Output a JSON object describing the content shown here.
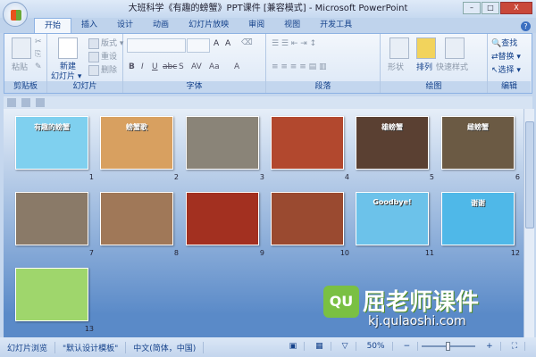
{
  "window": {
    "title": "大班科学《有趣的螃蟹》PPT课件 [兼容模式] - Microsoft PowerPoint",
    "min": "–",
    "max": "□",
    "close": "X"
  },
  "tabs": [
    "开始",
    "插入",
    "设计",
    "动画",
    "幻灯片放映",
    "审阅",
    "视图",
    "开发工具"
  ],
  "ribbon": {
    "clipboard": {
      "paste": "粘贴",
      "label": "剪贴板"
    },
    "slides": {
      "new": "新建",
      "new2": "幻灯片 ▾",
      "layout": "版式 ▾",
      "reset": "重设",
      "delete": "删除",
      "label": "幻灯片"
    },
    "font": {
      "grow": "A",
      "shrink": "A",
      "bold": "B",
      "italic": "I",
      "underline": "U",
      "strike": "abc",
      "shadow": "S",
      "spacing": "AV",
      "case": "Aa",
      "color": "A",
      "label": "字体"
    },
    "paragraph": {
      "label": "段落"
    },
    "drawing": {
      "shapes": "形状",
      "arrange": "排列",
      "quickstyles": "快速样式",
      "label": "绘图"
    },
    "editing": {
      "find": "查找",
      "replace": "替换 ▾",
      "select": "选择 ▾",
      "label": "编辑"
    }
  },
  "slides": [
    {
      "n": "1",
      "title": "有趣的螃蟹",
      "bg": "#7fd0ef"
    },
    {
      "n": "2",
      "title": "螃蟹歌",
      "bg": "#d8a060"
    },
    {
      "n": "3",
      "title": "",
      "bg": "#8a8478"
    },
    {
      "n": "4",
      "title": "",
      "bg": "#b2482e"
    },
    {
      "n": "5",
      "title": "雄螃蟹",
      "bg": "#5a4032"
    },
    {
      "n": "6",
      "title": "雌螃蟹",
      "bg": "#6b5a44"
    },
    {
      "n": "7",
      "title": "",
      "bg": "#8a7a68"
    },
    {
      "n": "8",
      "title": "",
      "bg": "#a07858"
    },
    {
      "n": "9",
      "title": "",
      "bg": "#a33020"
    },
    {
      "n": "10",
      "title": "",
      "bg": "#9a4a30"
    },
    {
      "n": "11",
      "title": "Goodbye!",
      "bg": "#6cc2ea"
    },
    {
      "n": "12",
      "title": "谢谢",
      "bg": "#4fb8e8"
    },
    {
      "n": "13",
      "title": "",
      "bg": "#9fd66c"
    }
  ],
  "status": {
    "view": "幻灯片浏览",
    "theme": "\"默认设计模板\"",
    "lang": "中文(简体，中国)",
    "zoom": "50%",
    "zoom_minus": "−",
    "zoom_plus": "+"
  },
  "watermark": {
    "badge": "QU",
    "name": "屈老师课件",
    "url": "kj.qulaoshi.com"
  }
}
